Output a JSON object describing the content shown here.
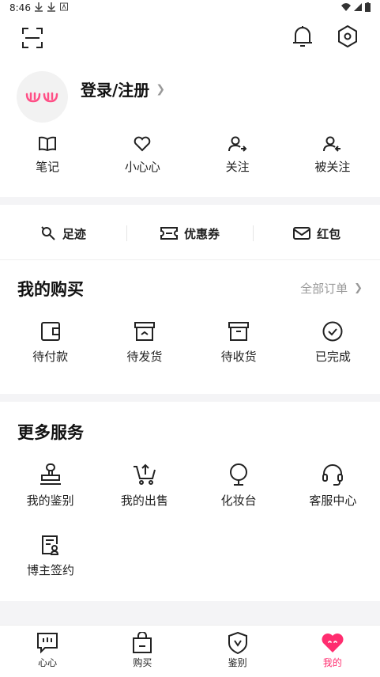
{
  "status_bar": {
    "time": "8:46"
  },
  "profile": {
    "login_label": "登录/注册",
    "avatar_text": "心心"
  },
  "stats": [
    {
      "label": "笔记",
      "icon": "book-icon"
    },
    {
      "label": "小心心",
      "icon": "heart-icon"
    },
    {
      "label": "关注",
      "icon": "user-follow-icon"
    },
    {
      "label": "被关注",
      "icon": "user-followed-icon"
    }
  ],
  "quick_links": [
    {
      "label": "足迹",
      "icon": "footprint-icon"
    },
    {
      "label": "优惠券",
      "icon": "coupon-icon"
    },
    {
      "label": "红包",
      "icon": "envelope-icon"
    }
  ],
  "purchases": {
    "title": "我的购买",
    "all_orders": "全部订单",
    "items": [
      {
        "label": "待付款",
        "icon": "wallet-icon"
      },
      {
        "label": "待发货",
        "icon": "box-icon"
      },
      {
        "label": "待收货",
        "icon": "box-receive-icon"
      },
      {
        "label": "已完成",
        "icon": "check-circle-icon"
      }
    ]
  },
  "services": {
    "title": "更多服务",
    "items": [
      {
        "label": "我的鉴别",
        "icon": "stamp-icon"
      },
      {
        "label": "我的出售",
        "icon": "cart-upload-icon"
      },
      {
        "label": "化妆台",
        "icon": "mirror-icon"
      },
      {
        "label": "客服中心",
        "icon": "headset-icon"
      },
      {
        "label": "博主签约",
        "icon": "contract-icon"
      }
    ]
  },
  "tabs": [
    {
      "label": "心心",
      "icon": "chat-icon",
      "active": false
    },
    {
      "label": "购买",
      "icon": "bag-icon",
      "active": false
    },
    {
      "label": "鉴别",
      "icon": "shield-icon",
      "active": false
    },
    {
      "label": "我的",
      "icon": "heart-face-icon",
      "active": true
    }
  ],
  "colors": {
    "accent": "#ff2d6f",
    "divider": "#f4f4f6",
    "muted": "#999999"
  }
}
